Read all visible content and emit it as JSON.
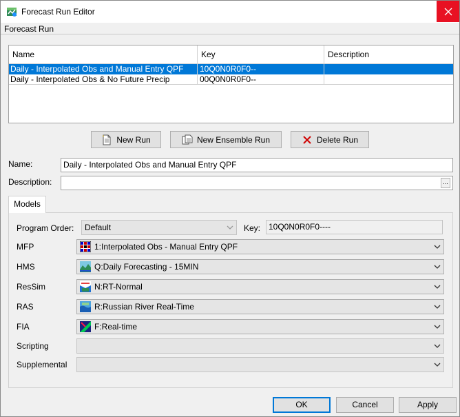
{
  "window": {
    "title": "Forecast Run Editor",
    "menu_label": "Forecast Run"
  },
  "table": {
    "headers": [
      "Name",
      "Key",
      "Description"
    ],
    "rows": [
      {
        "name": "Daily - Interpolated Obs and Manual Entry QPF",
        "key": "10Q0N0R0F0--",
        "description": "",
        "selected": true
      },
      {
        "name": "Daily - Interpolated Obs & No Future Precip",
        "key": "00Q0N0R0F0--",
        "description": "",
        "selected": false
      }
    ]
  },
  "buttons": {
    "new_run": "New Run",
    "new_ensemble_run": "New Ensemble Run",
    "delete_run": "Delete Run"
  },
  "form": {
    "name_label": "Name:",
    "name_value": "Daily - Interpolated Obs and Manual Entry QPF",
    "description_label": "Description:",
    "description_value": "",
    "browse_label": "..."
  },
  "models_tab": {
    "tab_label": "Models",
    "program_order_label": "Program Order:",
    "program_order_value": "Default",
    "key_label": "Key:",
    "key_value": "10Q0N0R0F0----",
    "rows": [
      {
        "label": "MFP",
        "value": "1:Interpolated Obs - Manual Entry QPF",
        "icon": "grid-icon"
      },
      {
        "label": "HMS",
        "value": "Q:Daily Forecasting - 15MIN",
        "icon": "hms-icon"
      },
      {
        "label": "ResSim",
        "value": "N:RT-Normal",
        "icon": "ressim-icon"
      },
      {
        "label": "RAS",
        "value": "R:Russian River Real-Time",
        "icon": "ras-icon"
      },
      {
        "label": "FIA",
        "value": "F:Real-time",
        "icon": "fia-icon"
      },
      {
        "label": "Scripting",
        "value": "",
        "icon": ""
      },
      {
        "label": "Supplemental",
        "value": "",
        "icon": ""
      }
    ]
  },
  "dialog_buttons": {
    "ok": "OK",
    "cancel": "Cancel",
    "apply": "Apply"
  },
  "colors": {
    "selection": "#0078d7",
    "close_button": "#e81123"
  }
}
